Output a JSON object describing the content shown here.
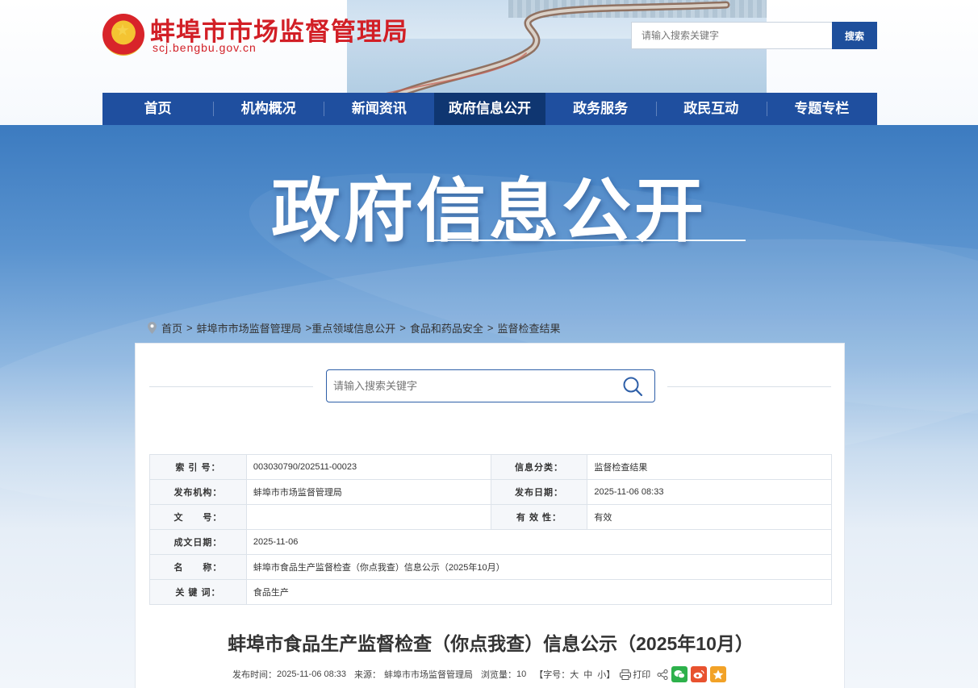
{
  "header": {
    "site_title": "蚌埠市市场监督管理局",
    "site_domain": "scj.bengbu.gov.cn",
    "search_placeholder": "请输入搜索关键字",
    "search_button": "搜索"
  },
  "nav": {
    "items": [
      {
        "label": "首页"
      },
      {
        "label": "机构概况"
      },
      {
        "label": "新闻资讯"
      },
      {
        "label": "政府信息公开"
      },
      {
        "label": "政务服务"
      },
      {
        "label": "政民互动"
      },
      {
        "label": "专题专栏"
      }
    ],
    "active_index": 3
  },
  "banner": {
    "title": "政府信息公开"
  },
  "breadcrumb": {
    "items": [
      "首页",
      "蚌埠市市场监督管理局",
      "重点领域信息公开",
      "食品和药品安全",
      "监督检查结果"
    ],
    "separators": [
      ">",
      ">",
      ">",
      ">"
    ]
  },
  "content_search": {
    "placeholder": "请输入搜索关键字"
  },
  "meta": {
    "index_label": "索 引 号：",
    "index_value": "003030790/202511-00023",
    "category_label": "信息分类：",
    "category_value": "监督检查结果",
    "publisher_label": "发布机构：",
    "publisher_value": "蚌埠市市场监督管理局",
    "pub_date_label": "发布日期：",
    "pub_date_value": "2025-11-06 08:33",
    "doc_no_label": "文　　号：",
    "doc_no_value": "",
    "validity_label": "有 效 性：",
    "validity_value": "有效",
    "written_date_label": "成文日期：",
    "written_date_value": "2025-11-06",
    "name_label": "名　　称：",
    "name_value": "蚌埠市食品生产监督检查（你点我查）信息公示（2025年10月）",
    "keywords_label": "关 键 词：",
    "keywords_value": "食品生产"
  },
  "article": {
    "title": "蚌埠市食品生产监督检查（你点我查）信息公示（2025年10月）",
    "time_label": "发布时间：",
    "time_value": "2025-11-06 08:33",
    "source_label": "来源：",
    "source_value": "蚌埠市市场监督管理局",
    "views_label": "浏览量：",
    "views_value": "10",
    "font_size_prefix": "【字号：",
    "font_large": "大",
    "font_medium": "中",
    "font_small": "小",
    "font_size_suffix": "】",
    "print_label": "打印"
  },
  "colors": {
    "brand_red": "#d21f26",
    "nav_blue": "#1f4f9f",
    "nav_active": "#0f3671"
  }
}
